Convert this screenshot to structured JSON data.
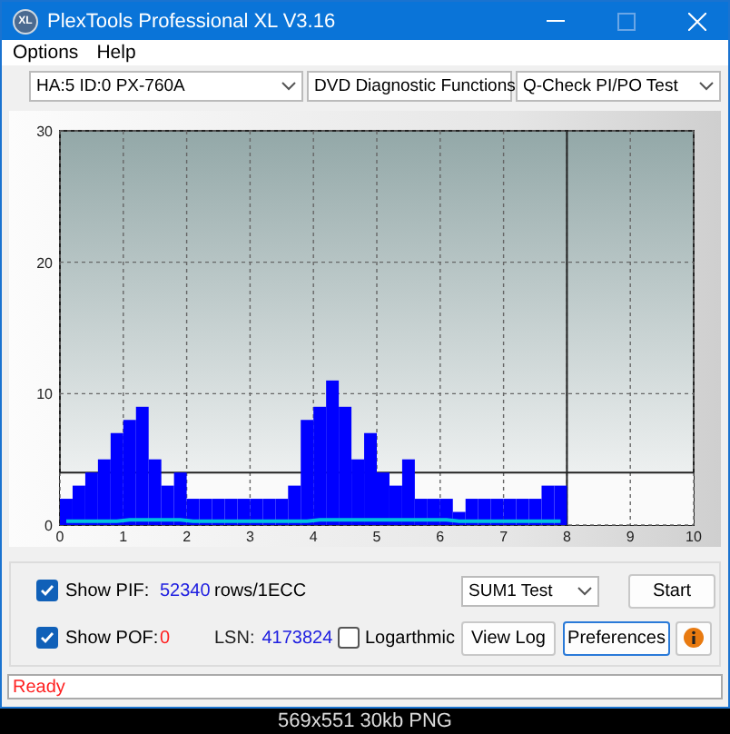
{
  "window": {
    "title": "PlexTools Professional XL V3.16",
    "logo_text": "XL"
  },
  "menu": [
    "Options",
    "Help"
  ],
  "toolbar": [
    {
      "value": "HA:5 ID:0  PX-760A"
    },
    {
      "value": "DVD Diagnostic Functions"
    },
    {
      "value": "Q-Check PI/PO Test"
    }
  ],
  "chart": {
    "chart_data": {
      "type": "bar",
      "x": [
        0.1,
        0.3,
        0.5,
        0.7,
        0.9,
        1.1,
        1.3,
        1.5,
        1.7,
        1.9,
        2.1,
        2.3,
        2.5,
        2.7,
        2.9,
        3.1,
        3.3,
        3.5,
        3.7,
        3.9,
        4.1,
        4.3,
        4.5,
        4.7,
        4.9,
        5.1,
        5.3,
        5.5,
        5.7,
        5.9,
        6.1,
        6.3,
        6.5,
        6.7,
        6.9,
        7.1,
        7.3,
        7.5,
        7.7,
        7.9
      ],
      "series": [
        {
          "color": "#0000ff",
          "values": [
            2,
            3,
            4,
            5,
            7,
            8,
            9,
            5,
            3,
            4,
            2,
            2,
            2,
            2,
            2,
            2,
            2,
            2,
            3,
            8,
            9,
            11,
            9,
            5,
            7,
            4,
            3,
            5,
            2,
            2,
            2,
            1,
            2,
            2,
            2,
            2,
            2,
            2,
            3,
            3
          ]
        },
        {
          "type": "line",
          "color": "#00c0e0",
          "values": [
            0.3,
            0.3,
            0.3,
            0.3,
            0.3,
            0.4,
            0.4,
            0.4,
            0.4,
            0.4,
            0.3,
            0.3,
            0.3,
            0.3,
            0.3,
            0.3,
            0.3,
            0.3,
            0.3,
            0.3,
            0.4,
            0.4,
            0.4,
            0.4,
            0.4,
            0.4,
            0.4,
            0.4,
            0.4,
            0.4,
            0.4,
            0.3,
            0.3,
            0.3,
            0.3,
            0.3,
            0.3,
            0.3,
            0.3,
            0.3
          ]
        }
      ],
      "xlim": [
        0,
        10
      ],
      "ylim": [
        0,
        30
      ],
      "xticks": [
        0,
        1,
        2,
        3,
        4,
        5,
        6,
        7,
        8,
        9,
        10
      ],
      "yticks": [
        0,
        10,
        20,
        30
      ],
      "grid": true,
      "bands": [
        {
          "axis": "y",
          "from": 0,
          "to": 4,
          "color": "#fafafa"
        }
      ],
      "ref_lines": [
        {
          "axis": "y",
          "value": 4
        },
        {
          "axis": "x",
          "value": 8
        }
      ]
    }
  },
  "controls": {
    "show_pif": {
      "label": "Show PIF:",
      "checked": true,
      "value": "52340"
    },
    "unit": "rows/1ECC",
    "show_pof": {
      "label": "Show POF:",
      "checked": true,
      "value": "0"
    },
    "lsn_label": "LSN:",
    "lsn_value": "4173824",
    "logarithmic": {
      "label": "Logarthmic",
      "checked": false
    },
    "test_select": "SUM1 Test",
    "buttons": [
      "Start",
      "View Log",
      "Preferences"
    ]
  },
  "status_bar": "Ready",
  "caption": "569x551 30kb PNG"
}
